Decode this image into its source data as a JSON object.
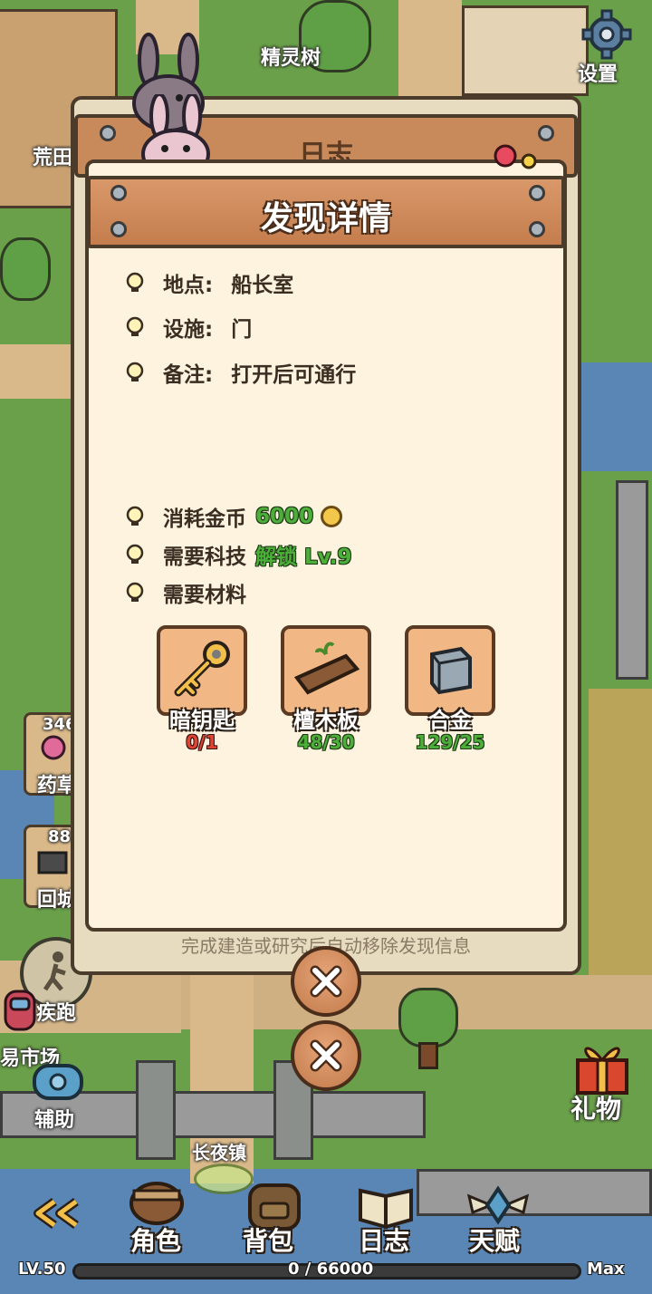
{
  "map": {
    "labels": {
      "spirit_tree": "精灵树",
      "wasteland": "荒田",
      "settings": "设置",
      "herb_count": "346",
      "herb": "药草",
      "recall_count": "88",
      "recall": "回城",
      "sprint": "疾跑",
      "market": "易市场",
      "assist": "辅助",
      "town": "长夜镇",
      "gift": "礼物"
    }
  },
  "back_panel": {
    "title": "日志",
    "footer": "完成建造或研究后自动移除发现信息"
  },
  "detail": {
    "title": "发现详情",
    "location_label": "地点:",
    "location_value": "船长室",
    "facility_label": "设施:",
    "facility_value": "门",
    "note_label": "备注:",
    "note_value": "打开后可通行",
    "cost_label": "消耗金币",
    "cost_value": "6000",
    "tech_label": "需要科技",
    "tech_value": "解锁 Lv.9",
    "materials_label": "需要材料",
    "materials": [
      {
        "name": "暗钥匙",
        "count": "0/1",
        "status": "insufficient"
      },
      {
        "name": "檀木板",
        "count": "48/30",
        "status": "ok"
      },
      {
        "name": "合金",
        "count": "129/25",
        "status": "ok"
      }
    ]
  },
  "bottom_nav": {
    "character": "角色",
    "backpack": "背包",
    "log": "日志",
    "talent": "天赋"
  },
  "level": {
    "level": "LV.50",
    "xp": "0 / 66000",
    "max": "Max",
    "progress": 0
  },
  "colors": {
    "panel_bg": "#fdf3df",
    "header_wood": "#c47d4d",
    "green_ok": "#4caf3a",
    "red_insufficient": "#e04434",
    "border_dark": "#4a3b2a"
  }
}
